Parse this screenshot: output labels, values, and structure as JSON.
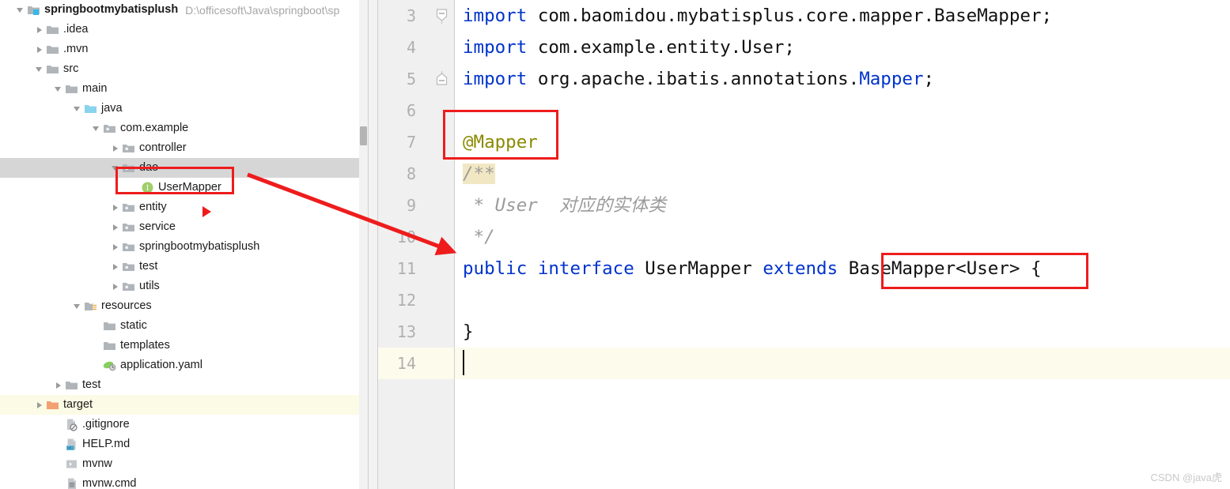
{
  "project": {
    "root_name": "springbootmybatisplush",
    "root_path": "D:\\officesoft\\Java\\springboot\\sp",
    "items": [
      {
        "label": ".idea",
        "indent": 1,
        "icon": "folder-icon",
        "twisty": "collapsed",
        "row": "none"
      },
      {
        "label": ".mvn",
        "indent": 1,
        "icon": "folder-icon",
        "twisty": "collapsed",
        "row": "none"
      },
      {
        "label": "src",
        "indent": 1,
        "icon": "folder-icon",
        "twisty": "expanded",
        "row": "none"
      },
      {
        "label": "main",
        "indent": 2,
        "icon": "folder-icon",
        "twisty": "expanded",
        "row": "none"
      },
      {
        "label": "java",
        "indent": 3,
        "icon": "source-folder-icon",
        "twisty": "expanded",
        "row": "none"
      },
      {
        "label": "com.example",
        "indent": 4,
        "icon": "package-icon",
        "twisty": "expanded",
        "row": "none"
      },
      {
        "label": "controller",
        "indent": 5,
        "icon": "package-icon",
        "twisty": "collapsed",
        "row": "none"
      },
      {
        "label": "dao",
        "indent": 5,
        "icon": "package-icon",
        "twisty": "expanded",
        "row": "selected"
      },
      {
        "label": "UserMapper",
        "indent": 6,
        "icon": "interface-icon",
        "twisty": "none",
        "row": "none"
      },
      {
        "label": "entity",
        "indent": 5,
        "icon": "package-icon",
        "twisty": "collapsed",
        "row": "none"
      },
      {
        "label": "service",
        "indent": 5,
        "icon": "package-icon",
        "twisty": "collapsed",
        "row": "none"
      },
      {
        "label": "springbootmybatisplush",
        "indent": 5,
        "icon": "package-icon",
        "twisty": "collapsed",
        "row": "none"
      },
      {
        "label": "test",
        "indent": 5,
        "icon": "package-icon",
        "twisty": "collapsed",
        "row": "none"
      },
      {
        "label": "utils",
        "indent": 5,
        "icon": "package-icon",
        "twisty": "collapsed",
        "row": "none"
      },
      {
        "label": "resources",
        "indent": 3,
        "icon": "resources-folder-icon",
        "twisty": "expanded",
        "row": "none"
      },
      {
        "label": "static",
        "indent": 4,
        "icon": "folder-icon",
        "twisty": "none",
        "row": "none"
      },
      {
        "label": "templates",
        "indent": 4,
        "icon": "folder-icon",
        "twisty": "none",
        "row": "none"
      },
      {
        "label": "application.yaml",
        "indent": 4,
        "icon": "yaml-file-icon",
        "twisty": "none",
        "row": "none"
      },
      {
        "label": "test",
        "indent": 2,
        "icon": "folder-icon",
        "twisty": "collapsed",
        "row": "none"
      },
      {
        "label": "target",
        "indent": 1,
        "icon": "target-folder-icon",
        "twisty": "collapsed",
        "row": "highlighted"
      },
      {
        "label": ".gitignore",
        "indent": 2,
        "icon": "gitignore-file-icon",
        "twisty": "none",
        "row": "none"
      },
      {
        "label": "HELP.md",
        "indent": 2,
        "icon": "markdown-file-icon",
        "twisty": "none",
        "row": "none"
      },
      {
        "label": "mvnw",
        "indent": 2,
        "icon": "script-file-icon",
        "twisty": "none",
        "row": "none"
      },
      {
        "label": "mvnw.cmd",
        "indent": 2,
        "icon": "cmd-file-icon",
        "twisty": "none",
        "row": "none"
      }
    ]
  },
  "editor": {
    "current_line": 14,
    "lines": [
      {
        "no": "3",
        "fold": "fold-collapse-start",
        "tokens": [
          {
            "t": "import ",
            "c": "kw"
          },
          {
            "t": "com.baomidou.mybatisplus.core.mapper.BaseMapper;",
            "c": "plain"
          }
        ]
      },
      {
        "no": "4",
        "fold": "none",
        "tokens": [
          {
            "t": "import ",
            "c": "kw"
          },
          {
            "t": "com.example.entity.User;",
            "c": "plain"
          }
        ]
      },
      {
        "no": "5",
        "fold": "fold-collapse-end",
        "tokens": [
          {
            "t": "import ",
            "c": "kw"
          },
          {
            "t": "org.apache.ibatis.annotations.",
            "c": "plain"
          },
          {
            "t": "Mapper",
            "c": "kw"
          },
          {
            "t": ";",
            "c": "plain"
          }
        ]
      },
      {
        "no": "6",
        "fold": "none",
        "tokens": []
      },
      {
        "no": "7",
        "fold": "none",
        "tokens": [
          {
            "t": "@Mapper",
            "c": "anno"
          }
        ]
      },
      {
        "no": "8",
        "fold": "none",
        "tokens": [
          {
            "t": "/**",
            "c": "cmt cmt-hl"
          }
        ]
      },
      {
        "no": "9",
        "fold": "none",
        "tokens": [
          {
            "t": " * User  对应的实体类",
            "c": "cmt"
          }
        ]
      },
      {
        "no": "10",
        "fold": "none",
        "tokens": [
          {
            "t": " */",
            "c": "cmt"
          }
        ]
      },
      {
        "no": "11",
        "fold": "none",
        "tokens": [
          {
            "t": "public ",
            "c": "kw"
          },
          {
            "t": "interface ",
            "c": "kw"
          },
          {
            "t": "UserMapper ",
            "c": "plain"
          },
          {
            "t": "extends ",
            "c": "kw"
          },
          {
            "t": "BaseMapper<User> {",
            "c": "plain"
          }
        ]
      },
      {
        "no": "12",
        "fold": "none",
        "tokens": []
      },
      {
        "no": "13",
        "fold": "none",
        "tokens": [
          {
            "t": "}",
            "c": "plain"
          }
        ]
      },
      {
        "no": "14",
        "fold": "none",
        "tokens": []
      }
    ]
  },
  "annotations": {
    "box_usermapper_label": "UserMapper",
    "box_mapper_label": "@Mapper",
    "box_basemapper_label": "BaseMapper<User>",
    "arrow_label": "red-arrow-from-usermapper-to-code",
    "accent_color": "#ee1c1c"
  },
  "watermark": {
    "text": "CSDN @java虎"
  }
}
